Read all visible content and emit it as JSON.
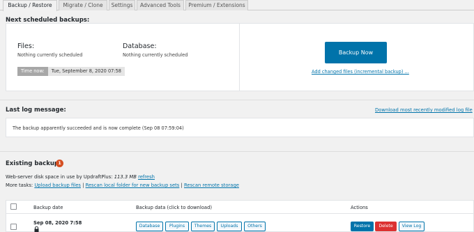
{
  "tabs": [
    "Backup / Restore",
    "Migrate / Clone",
    "Settings",
    "Advanced Tools",
    "Premium / Extensions"
  ],
  "scheduled": {
    "heading": "Next scheduled backups:",
    "files_label": "Files:",
    "files_value": "Nothing currently scheduled",
    "db_label": "Database:",
    "db_value": "Nothing currently scheduled",
    "time_now_label": "Time now:",
    "time_now_value": "Tue, September 8, 2020 07:58",
    "backup_now": "Backup Now",
    "incremental_link": "Add changed files (incremental backup) ..."
  },
  "log": {
    "heading": "Last log message:",
    "download_link": "Download most recently modified log file",
    "message": "The backup apparently succeeded and is now complete (Sep 08 07:59:04)"
  },
  "existing": {
    "heading": "Existing backups",
    "count": "1",
    "disk_prefix": "Web-server disk space in use by UpdraftPlus:",
    "disk_value": "113.3 MB",
    "refresh": "refresh",
    "more_tasks": "More tasks:",
    "upload_link": "Upload backup files",
    "sep": "|",
    "rescan_local": "Rescan local folder for new backup sets",
    "rescan_remote": "Rescan remote storage"
  },
  "table": {
    "col_date": "Backup date",
    "col_data": "Backup data (click to download)",
    "col_actions": "Actions",
    "row": {
      "date": "Sep 08, 2020 7:58",
      "lock_icon": "lock-icon",
      "data_buttons": [
        "Database",
        "Plugins",
        "Themes",
        "Uploads",
        "Others"
      ],
      "actions": [
        "Restore",
        "Delete",
        "View Log"
      ]
    }
  },
  "colors": {
    "primary": "#0073aa",
    "danger": "#dc3232",
    "badge": "#d54e21"
  }
}
